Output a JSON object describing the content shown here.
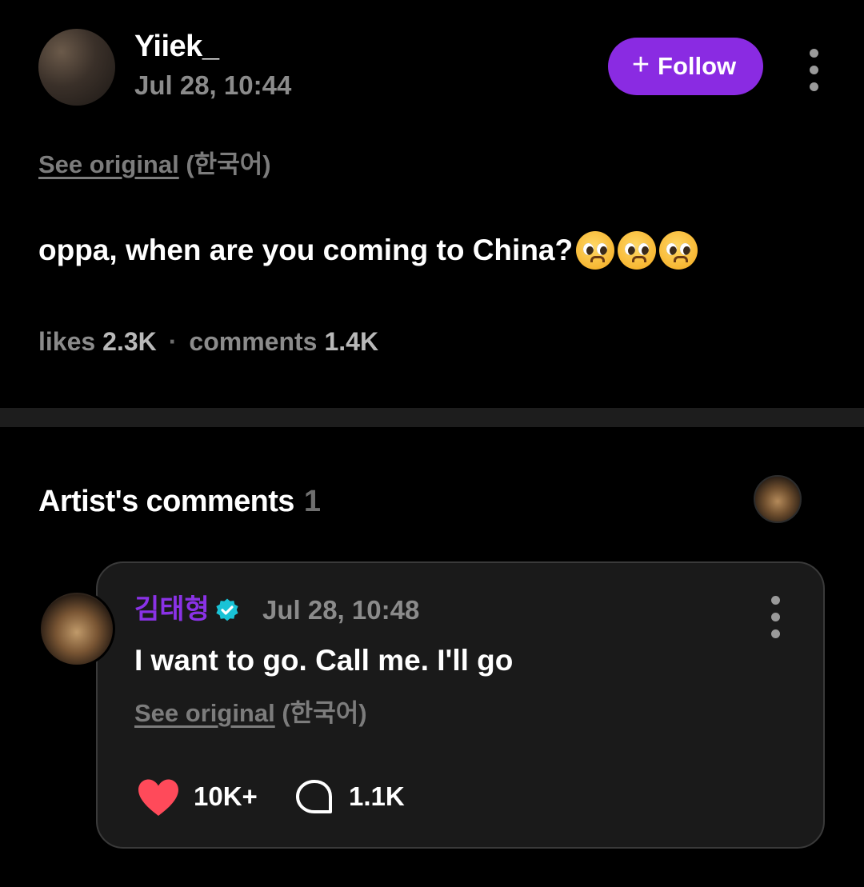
{
  "post": {
    "author": "Yiiek_",
    "timestamp": "Jul 28, 10:44",
    "follow_label": "Follow",
    "see_original_label": "See original",
    "original_language": "(한국어)",
    "text": "oppa, when are you coming to China?",
    "emoji": "pleading-face",
    "likes_label": "likes",
    "likes_value": "2.3K",
    "separator": "·",
    "comments_label": "comments",
    "comments_value": "1.4K"
  },
  "artist_section": {
    "title": "Artist's comments",
    "count": "1"
  },
  "artist_comment": {
    "author": "김태형",
    "timestamp": "Jul 28, 10:48",
    "text": "I want to go. Call me. I'll go",
    "see_original_label": "See original",
    "original_language": "(한국어)",
    "likes": "10K+",
    "replies": "1.1K"
  },
  "colors": {
    "background": "#000000",
    "accent_purple": "#8a2be2",
    "artist_name": "#8a32e6",
    "verified_badge": "#19c3d6",
    "heart": "#ff4a5a",
    "muted_text": "#8b8b8b"
  },
  "icons": {
    "follow": "plus-icon",
    "more": "more-vertical-icon",
    "verified": "verified-badge-icon",
    "like": "heart-icon",
    "reply": "comment-bubble-icon"
  }
}
